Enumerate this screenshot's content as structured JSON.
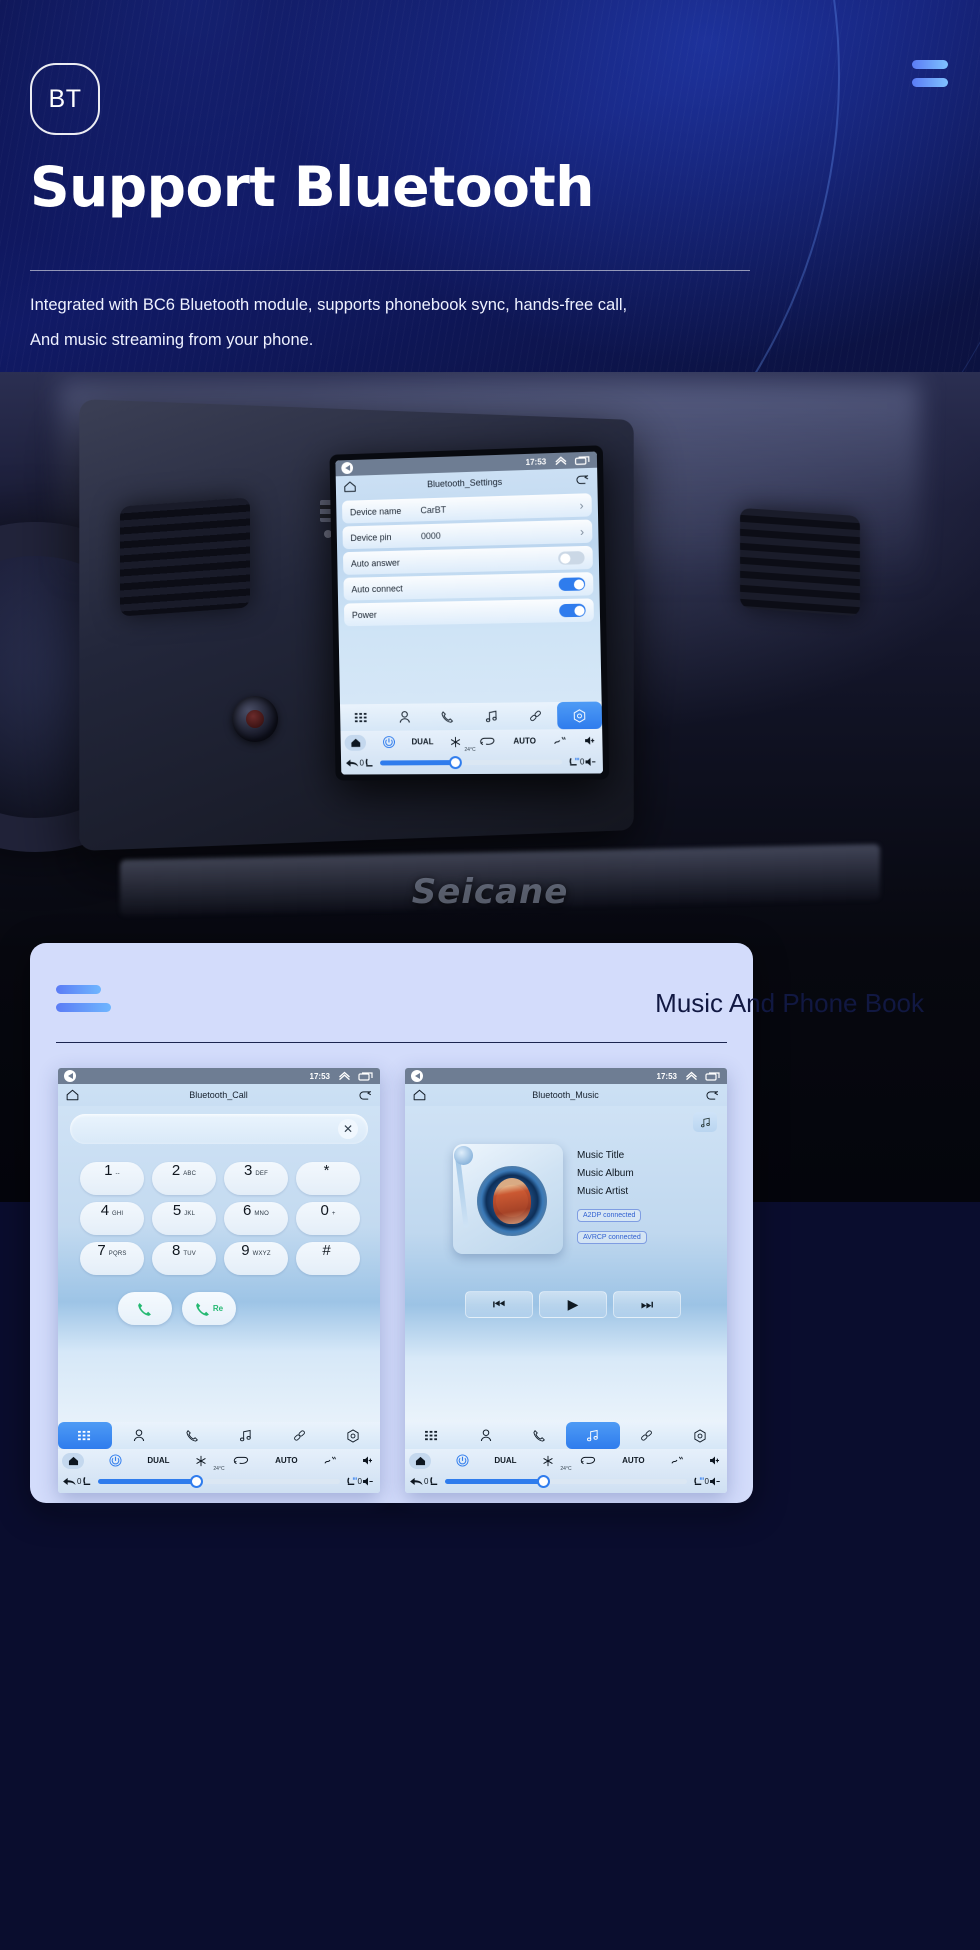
{
  "hero": {
    "badge_label": "BT",
    "title": "Support Bluetooth",
    "subtitle_line1": "Integrated with BC6 Bluetooth module, supports phonebook sync, hands-free call,",
    "subtitle_line2": "And music streaming from your phone.",
    "menu_icon": "hamburger-icon",
    "accent_color": "#5b7cf5"
  },
  "photo": {
    "watermark": "Seicane"
  },
  "head_unit": {
    "statusbar": {
      "time": "17:53",
      "back_icon": "back-circle-icon",
      "up_icon": "chevron-up-icon",
      "recents_icon": "recents-icon"
    },
    "titlebar": {
      "home_icon": "home-icon",
      "title": "Bluetooth_Settings",
      "back_icon": "return-arrow-icon"
    },
    "rows": [
      {
        "label": "Device name",
        "value": "CarBT",
        "control": "chevron",
        "chevron": "›"
      },
      {
        "label": "Device pin",
        "value": "0000",
        "control": "chevron",
        "chevron": "›"
      },
      {
        "label": "Auto answer",
        "value": "",
        "control": "toggle",
        "state": "off"
      },
      {
        "label": "Auto connect",
        "value": "",
        "control": "toggle",
        "state": "on"
      },
      {
        "label": "Power",
        "value": "",
        "control": "toggle",
        "state": "on"
      }
    ],
    "appbar": [
      {
        "icon": "apps-grid-icon",
        "active": false
      },
      {
        "icon": "contact-person-icon",
        "active": false
      },
      {
        "icon": "phone-handset-icon",
        "active": false
      },
      {
        "icon": "music-note-icon",
        "active": false
      },
      {
        "icon": "link-chain-icon",
        "active": false
      },
      {
        "icon": "settings-hex-icon",
        "active": true
      }
    ],
    "climate": {
      "home_icon": "home-filled-icon",
      "power_icon": "power-icon",
      "dual_label": "DUAL",
      "snowflake_icon": "snowflake-icon",
      "recirculate_icon": "recirculate-icon",
      "auto_label": "AUTO",
      "defrost_icon": "defrost-icon",
      "volume_up_icon": "volume-up-icon",
      "back_icon": "back-arrow-icon",
      "left_temp": "0",
      "seat_left_icon": "seat-icon",
      "temperature": "24°C",
      "seat_heat_icon": "seat-heated-icon",
      "right_temp": "0",
      "volume_down_icon": "volume-down-icon",
      "fan_knob_icon": "fan-icon"
    }
  },
  "bottom_card": {
    "title": "Music And Phone Book",
    "bars_icon": "bars-decoration-icon",
    "call_panel": {
      "statusbar": {
        "time": "17:53",
        "back_icon": "back-circle-icon",
        "up_icon": "chevron-up-icon",
        "recents_icon": "recents-icon"
      },
      "titlebar": {
        "home_icon": "home-icon",
        "title": "Bluetooth_Call",
        "back_icon": "return-arrow-icon"
      },
      "input_value": "",
      "clear_icon": "close-x-icon",
      "keys": [
        {
          "num": "1",
          "sub": "--"
        },
        {
          "num": "2",
          "sub": "ABC"
        },
        {
          "num": "3",
          "sub": "DEF"
        },
        {
          "num": "*",
          "sub": ""
        },
        {
          "num": "4",
          "sub": "GHI"
        },
        {
          "num": "5",
          "sub": "JKL"
        },
        {
          "num": "6",
          "sub": "MNO"
        },
        {
          "num": "0",
          "sub": "+"
        },
        {
          "num": "7",
          "sub": "PQRS"
        },
        {
          "num": "8",
          "sub": "TUV"
        },
        {
          "num": "9",
          "sub": "WXYZ"
        },
        {
          "num": "#",
          "sub": ""
        }
      ],
      "call_button_icon": "phone-call-icon",
      "redial_label": "Re",
      "redial_icon": "phone-redial-icon",
      "appbar": [
        {
          "icon": "apps-grid-icon",
          "active": true
        },
        {
          "icon": "contact-person-icon",
          "active": false
        },
        {
          "icon": "phone-handset-icon",
          "active": false
        },
        {
          "icon": "music-note-icon",
          "active": false
        },
        {
          "icon": "link-chain-icon",
          "active": false
        },
        {
          "icon": "settings-hex-icon",
          "active": false
        }
      ]
    },
    "music_panel": {
      "statusbar": {
        "time": "17:53",
        "back_icon": "back-circle-icon",
        "up_icon": "chevron-up-icon",
        "recents_icon": "recents-icon"
      },
      "titlebar": {
        "home_icon": "home-icon",
        "title": "Bluetooth_Music",
        "back_icon": "return-arrow-icon"
      },
      "list_badge_icon": "music-list-icon",
      "album_art_icon": "album-turntable-icon",
      "info": [
        "Music Title",
        "Music Album",
        "Music Artist"
      ],
      "chips": [
        "A2DP  connected",
        "AVRCP connected"
      ],
      "controls": [
        {
          "icon": "previous-track-icon",
          "glyph": "⏮"
        },
        {
          "icon": "play-icon",
          "glyph": "▶"
        },
        {
          "icon": "next-track-icon",
          "glyph": "⏭"
        }
      ],
      "appbar": [
        {
          "icon": "apps-grid-icon",
          "active": false
        },
        {
          "icon": "contact-person-icon",
          "active": false
        },
        {
          "icon": "phone-handset-icon",
          "active": false
        },
        {
          "icon": "music-note-icon",
          "active": true
        },
        {
          "icon": "link-chain-icon",
          "active": false
        },
        {
          "icon": "settings-hex-icon",
          "active": false
        }
      ]
    }
  }
}
